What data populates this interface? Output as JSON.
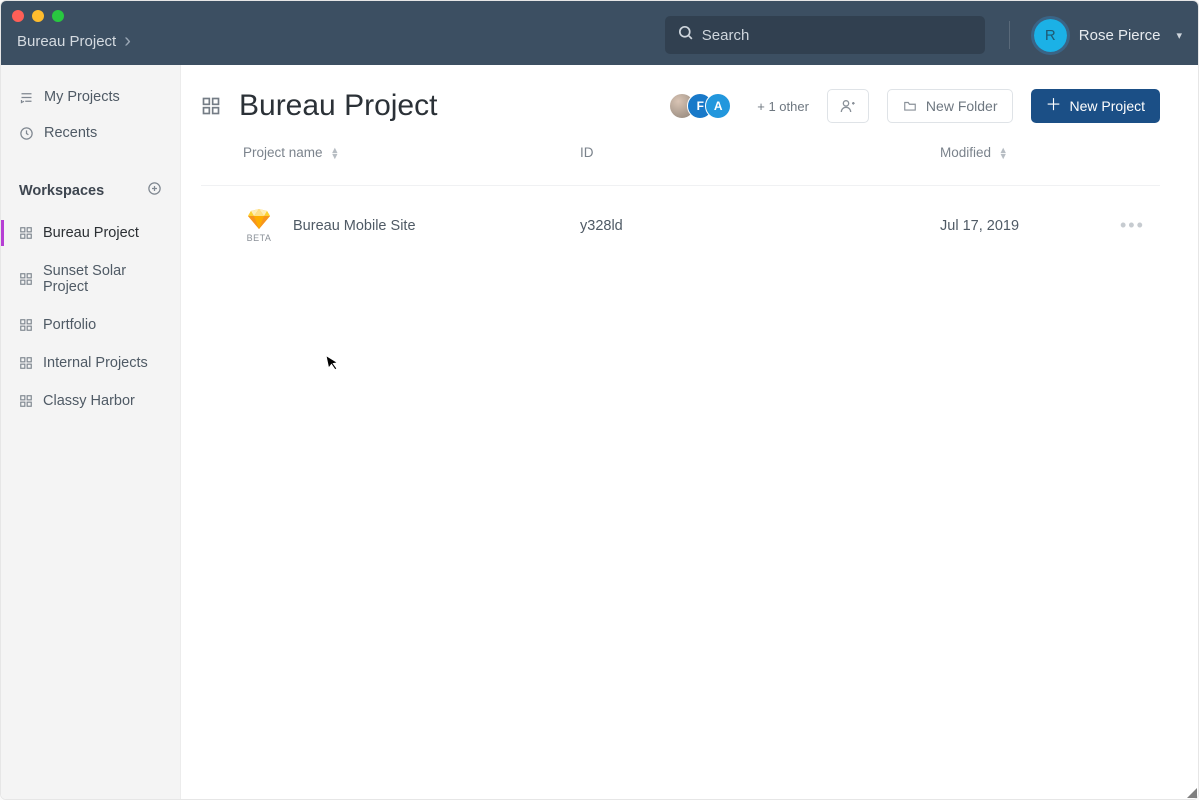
{
  "titlebar": {
    "breadcrumb": "Bureau Project",
    "search_placeholder": "Search",
    "user_initial": "R",
    "user_name": "Rose Pierce"
  },
  "sidebar": {
    "nav": [
      {
        "label": "My Projects"
      },
      {
        "label": "Recents"
      }
    ],
    "section_label": "Workspaces",
    "workspaces": [
      {
        "label": "Bureau Project",
        "active": true
      },
      {
        "label": "Sunset Solar Project",
        "active": false
      },
      {
        "label": "Portfolio",
        "active": false
      },
      {
        "label": "Internal Projects",
        "active": false
      },
      {
        "label": "Classy Harbor",
        "active": false
      }
    ]
  },
  "main": {
    "title": "Bureau Project",
    "share_avatars": [
      {
        "letter": "",
        "cls": "photo"
      },
      {
        "letter": "F",
        "cls": "f"
      },
      {
        "letter": "A",
        "cls": "a"
      }
    ],
    "share_more": "+ 1 other",
    "btn_new_folder": "New Folder",
    "btn_new_project": "New Project",
    "columns": {
      "name": "Project name",
      "id": "ID",
      "modified": "Modified"
    },
    "rows": [
      {
        "name": "Bureau Mobile Site",
        "badge": "BETA",
        "id": "y328ld",
        "modified": "Jul 17, 2019"
      }
    ]
  }
}
